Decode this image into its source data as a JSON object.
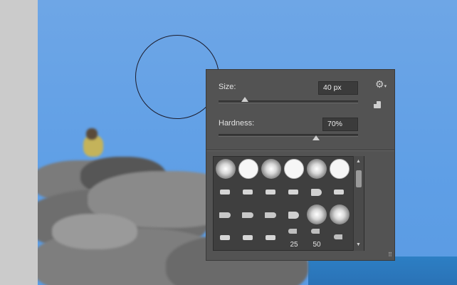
{
  "brush_panel": {
    "size": {
      "label": "Size:",
      "value": "40 px",
      "slider_fraction": 0.19
    },
    "hardness": {
      "label": "Hardness:",
      "value": "70%",
      "slider_fraction": 0.7
    },
    "presets": [
      {
        "kind": "soft-round"
      },
      {
        "kind": "hard-round"
      },
      {
        "kind": "soft-round"
      },
      {
        "kind": "hard-round"
      },
      {
        "kind": "soft-round"
      },
      {
        "kind": "hard-round"
      },
      {
        "kind": "bristle"
      },
      {
        "kind": "bristle"
      },
      {
        "kind": "bristle"
      },
      {
        "kind": "bristle"
      },
      {
        "kind": "fan"
      },
      {
        "kind": "bristle"
      },
      {
        "kind": "bristle"
      },
      {
        "kind": "bristle"
      },
      {
        "kind": "bristle"
      },
      {
        "kind": "fan"
      },
      {
        "kind": "soft-round"
      },
      {
        "kind": "soft-round"
      },
      {
        "kind": "bristle"
      },
      {
        "kind": "bristle"
      },
      {
        "kind": "bristle"
      },
      {
        "kind": "pen",
        "label": "25"
      },
      {
        "kind": "pen",
        "label": "50"
      },
      {
        "kind": "pen"
      }
    ],
    "icons": {
      "settings": "gear-icon",
      "new_preset": "new-preset-icon",
      "resize": "resize-grip-icon"
    }
  },
  "colors": {
    "panel": "#535353",
    "input": "#3b3b3b",
    "sky": "#6ea6e6",
    "sea": "#2d7fc4"
  }
}
